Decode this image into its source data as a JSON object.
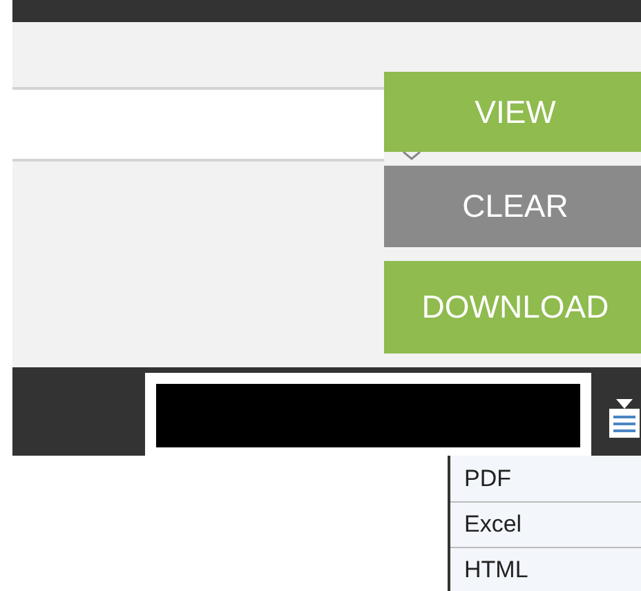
{
  "buttons": [
    {
      "label": "VIEW",
      "kind": "primary"
    },
    {
      "label": "CLEAR",
      "kind": "secondary"
    },
    {
      "label": "DOWNLOAD",
      "kind": "primary"
    }
  ],
  "export_menu": {
    "expanded": true,
    "items": [
      {
        "label": "PDF"
      },
      {
        "label": "Excel"
      },
      {
        "label": "HTML"
      }
    ]
  }
}
